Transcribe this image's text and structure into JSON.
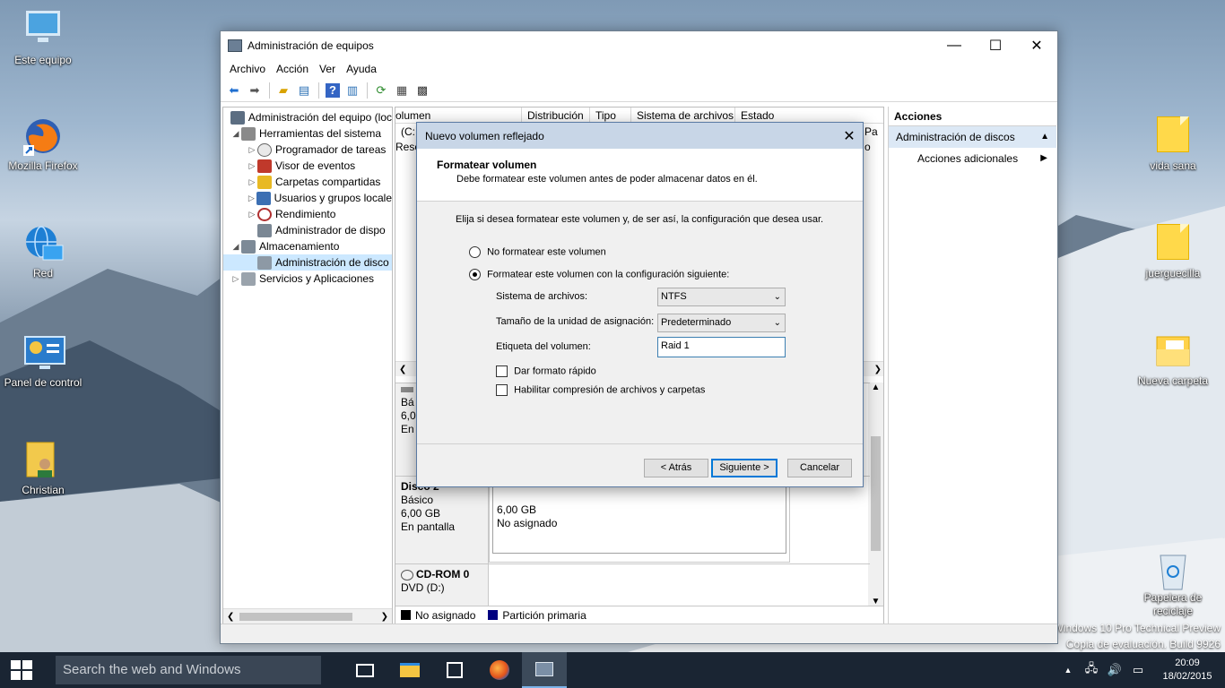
{
  "desktop": {
    "icons": [
      {
        "label": "Este equipo"
      },
      {
        "label": "Mozilla Firefox"
      },
      {
        "label": "Red"
      },
      {
        "label": "Panel de control"
      },
      {
        "label": "Christian"
      },
      {
        "label": "vida sana"
      },
      {
        "label": "juerguecilla"
      },
      {
        "label": "Nueva carpeta"
      },
      {
        "label": "Papelera de reciclaje"
      }
    ],
    "watermark": {
      "line1": "Windows 10 Pro Technical Preview",
      "line2": "Copia de evaluación. Build 9926"
    }
  },
  "window": {
    "title": "Administración de equipos",
    "controls": {
      "minimize": "—",
      "maximize": "☐",
      "close": "✕"
    },
    "menu": [
      "Archivo",
      "Acción",
      "Ver",
      "Ayuda"
    ],
    "tree": [
      {
        "label": "Administración del equipo (loc",
        "level": 0,
        "exp": ""
      },
      {
        "label": "Herramientas del sistema",
        "level": 1,
        "exp": "◢"
      },
      {
        "label": "Programador de tareas",
        "level": 2,
        "exp": "▷"
      },
      {
        "label": "Visor de eventos",
        "level": 2,
        "exp": "▷"
      },
      {
        "label": "Carpetas compartidas",
        "level": 2,
        "exp": "▷"
      },
      {
        "label": "Usuarios y grupos locale",
        "level": 2,
        "exp": "▷"
      },
      {
        "label": "Rendimiento",
        "level": 2,
        "exp": "▷"
      },
      {
        "label": "Administrador de dispo",
        "level": 2,
        "exp": ""
      },
      {
        "label": "Almacenamiento",
        "level": 1,
        "exp": "◢"
      },
      {
        "label": "Administración de disco",
        "level": 2,
        "exp": ""
      },
      {
        "label": "Servicios y Aplicaciones",
        "level": 1,
        "exp": "▷"
      }
    ],
    "columns": [
      "olumen",
      "Distribución",
      "Tipo",
      "Sistema de archivos",
      "Estado"
    ],
    "list_fragments": {
      "row1": "(C:",
      "row2": "Rese",
      "right1": "Pa",
      "right2": "o"
    },
    "disks": {
      "disk1_fragment": {
        "line1": "Bá",
        "line2": "6,0",
        "line3": "En"
      },
      "disk2": {
        "name": "Disco 2",
        "type": "Básico",
        "size": "6,00 GB",
        "status": "En pantalla",
        "partition_size": "6,00 GB",
        "partition_state": "No asignado"
      },
      "cdrom": {
        "name": "CD-ROM 0",
        "drive": "DVD (D:)"
      }
    },
    "legend": [
      {
        "label": "No asignado",
        "color": "#000000"
      },
      {
        "label": "Partición primaria",
        "color": "#000080"
      }
    ],
    "actions": {
      "header": "Acciones",
      "section": "Administración de discos",
      "item": "Acciones adicionales"
    }
  },
  "dialog": {
    "title": "Nuevo volumen reflejado",
    "heading": "Formatear volumen",
    "subheading": "Debe formatear este volumen antes de poder almacenar datos en él.",
    "instruction": "Elija si desea formatear este volumen y, de ser así, la configuración que desea usar.",
    "radio_no_format": "No formatear este volumen",
    "radio_format": "Formatear este volumen con la configuración siguiente:",
    "fs_label": "Sistema de archivos:",
    "fs_value": "NTFS",
    "alloc_label": "Tamaño de la unidad de asignación:",
    "alloc_value": "Predeterminado",
    "vol_label": "Etiqueta del volumen:",
    "vol_value": "Raid 1",
    "quick_format": "Dar formato rápido",
    "compression": "Habilitar compresión de archivos y carpetas",
    "btn_back": "< Atrás",
    "btn_next": "Siguiente >",
    "btn_cancel": "Cancelar"
  },
  "taskbar": {
    "search_placeholder": "Search the web and Windows",
    "time": "20:09",
    "date": "18/02/2015"
  }
}
